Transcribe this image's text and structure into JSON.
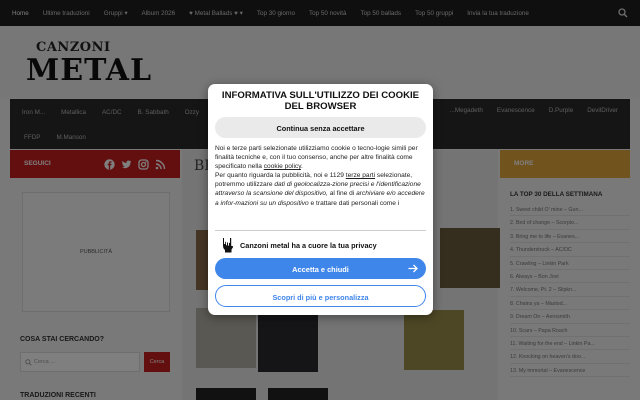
{
  "topnav": {
    "items": [
      "Home",
      "Ultime traduzioni",
      "Gruppi ▾",
      "Album 2026",
      "♥ Metal Ballads ♥ ▾",
      "Top 30 giorno",
      "Top 50 novità",
      "Top 50 ballads",
      "Top 50 gruppi",
      "Invia la tua traduzione"
    ]
  },
  "logo": {
    "top": "CANZONI",
    "main": "METAL"
  },
  "bandnav": {
    "row1": [
      "Iron M...",
      "Metallica",
      "AC/DC",
      "B. Sabbath",
      "Ozzy"
    ],
    "row1_right": [
      "...Megadeth",
      "Evanescence",
      "D.Purple",
      "DevilDriver"
    ],
    "row2": [
      "FFDP",
      "M.Manson"
    ]
  },
  "sidebar": {
    "seguici": "SEGUICI",
    "pubblicita": "PUBBLICITÀ",
    "cosa_stai_cercando": "COSA STAI CERCANDO?",
    "search_placeholder": "Cerca ...",
    "search_button": "Cerca",
    "traduzioni_recenti": "TRADUZIONI RECENTI"
  },
  "main": {
    "heading": "BE"
  },
  "right": {
    "more": "MORE",
    "top30_title": "LA TOP 30 DELLA SETTIMANA",
    "top30": [
      "1. Sweet child O' mine – Gun...",
      "2. Bed of change – Scorpio...",
      "3. Bring me to life – Evanes...",
      "4. Thunderstruck – AC/DC",
      "5. Crawling – Linkin Park",
      "6. Always – Bon Jovi",
      "7. Welcome, Pt. 2 – Slipkn...",
      "8. Chains ya – Mastod...",
      "9. Dream On – Aerosmith",
      "10. Scars – Papa Roach",
      "11. Waiting for the end – Linkin Pa...",
      "12. Knocking on heaven's doo...",
      "13. My immortal – Evanescence"
    ]
  },
  "modal": {
    "title": "INFORMATIVA SULL'UTILIZZO DEI COOKIE DEL BROWSER",
    "continue": "Continua senza accettare",
    "p1_a": "Noi e terze parti selezionate utilizziamo cookie o tecno-logie simili per finalità tecniche e, con il tuo consenso, anche per altre finalità come specificato nella ",
    "p1_link": "cookie policy",
    "p1_b": ".",
    "p2_a": "Per quanto riguarda la pubblicità, noi e 1129 ",
    "p2_link": "terze parti",
    "p2_b": " selezionate, potremmo utilizzare ",
    "p2_i1": "dati di geolocalizza-zione precisi e l'identificazione attraverso la scansione del dispositivo,",
    "p2_c": " al fine di ",
    "p2_i2": "archiviare e/o accedere a infor-mazioni su un dispositivo",
    "p2_d": " e trattare dati personali come i",
    "love": "Canzoni metal ha a cuore la tua privacy",
    "accept": "Accetta e chiudi",
    "more": "Scopri di più e personalizza"
  },
  "colors": {
    "red": "#c91f1f",
    "orange": "#e2a63a",
    "blue": "#3f86ea",
    "dark": "#1f1f1f"
  },
  "icons": [
    "search-icon",
    "facebook-icon",
    "twitter-icon",
    "instagram-icon",
    "rss-icon",
    "arrow-right-icon",
    "devil-hand-icon"
  ]
}
